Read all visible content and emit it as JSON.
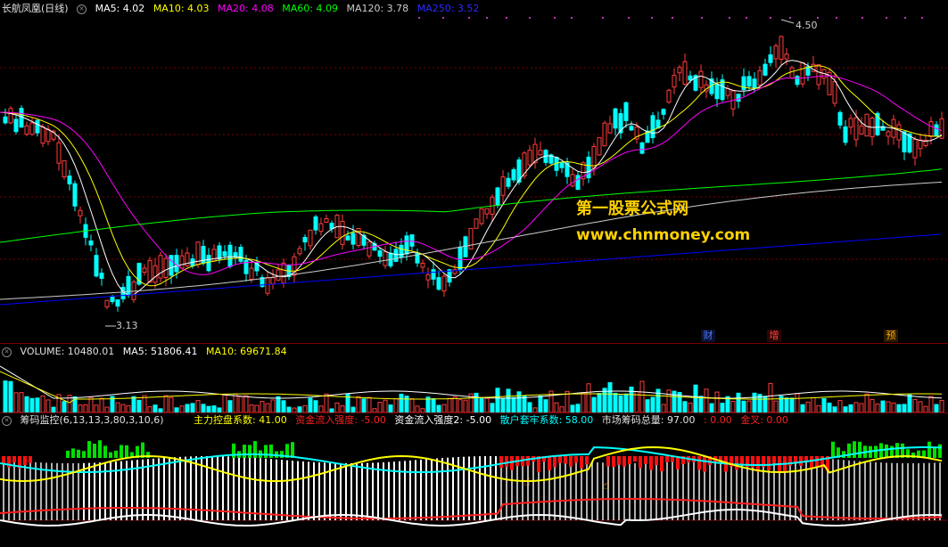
{
  "colors": {
    "bg": "#000000",
    "up": "#ff3c3c",
    "down": "#00ffff",
    "ma5": "#ffffff",
    "ma10": "#ffff00",
    "ma20": "#ff00ff",
    "ma60": "#00ff00",
    "ma120": "#cccccc",
    "ma250": "#0000ff",
    "grid": "#7a0000"
  },
  "main_panel": {
    "title": "长航凤凰(日线)",
    "ma5": "MA5: 4.02",
    "ma10": "MA10: 4.03",
    "ma20": "MA20: 4.08",
    "ma60": "MA60: 4.09",
    "ma120": "MA120: 3.78",
    "ma250": "MA250: 3.52",
    "high_label": "4.50",
    "low_label": "3.13",
    "badges": [
      "财",
      "增",
      "预"
    ]
  },
  "watermark": {
    "line1": "第一股票公式网",
    "line2": "www.chnmoney.com"
  },
  "volume_panel": {
    "volume": "VOLUME: 10480.01",
    "ma5": "MA5: 51806.41",
    "ma10": "MA10: 69671.84"
  },
  "indicator_panel": {
    "name": "筹码监控(6,13,13,3,80,3,10,6)",
    "zhuli": "主力控盘系数: 41.00",
    "zijin1": "资金流入强度: -5.00",
    "zijin2": "资金流入强度2: -5.00",
    "sanhu": "散户套牢系数: 58.00",
    "shichang": "市场筹码总量: 97.00",
    "extra": ": 0.00",
    "jincha": "金叉: 0.00"
  }
}
